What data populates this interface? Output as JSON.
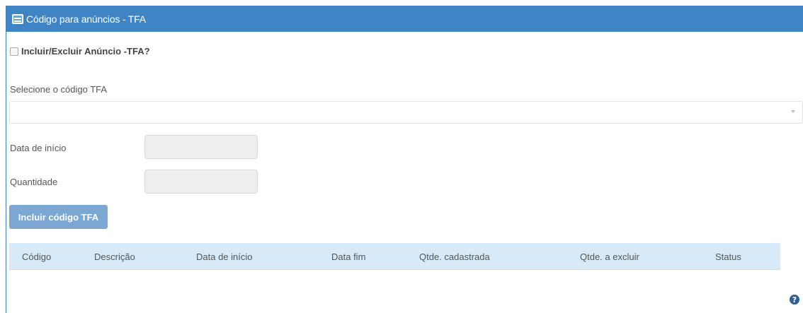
{
  "panel": {
    "title": "Código para anúncios - TFA"
  },
  "form": {
    "checkbox_label": "Incluir/Excluir Anúncio -TFA?",
    "select_label": "Selecione o código TFA",
    "select_value": "",
    "start_date_label": "Data de início",
    "start_date_value": "",
    "quantity_label": "Quantidade",
    "quantity_value": "",
    "add_button_label": "Incluir código TFA"
  },
  "table": {
    "columns": [
      "Código",
      "Descrição",
      "Data de início",
      "Data fim",
      "Qtde. cadastrada",
      "Qtde. a excluir",
      "Status"
    ],
    "rows": []
  },
  "footer": {
    "help_icon_glyph": "?"
  },
  "colors": {
    "header_bg": "#3f85c6",
    "button_bg": "#7ba7d2",
    "table_header_bg": "#d8eaf7"
  }
}
